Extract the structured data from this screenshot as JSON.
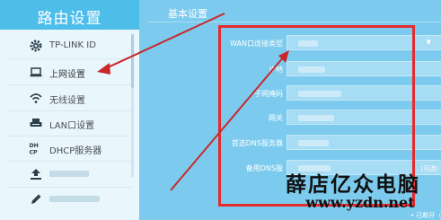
{
  "sidebar": {
    "title": "路由设置",
    "items": [
      {
        "label": "TP-LINK ID",
        "icon": "gear-icon",
        "active": false
      },
      {
        "label": "上网设置",
        "icon": "monitor-icon",
        "active": true
      },
      {
        "label": "无线设置",
        "icon": "wifi-icon",
        "active": false
      },
      {
        "label": "LAN口设置",
        "icon": "lan-switch-icon",
        "active": false
      },
      {
        "label": "DHCP服务器",
        "icon": "dhcp-icon",
        "active": false
      },
      {
        "label": "",
        "icon": "upload-icon",
        "active": false
      },
      {
        "label": "",
        "icon": "pencil-icon",
        "active": false
      }
    ]
  },
  "main": {
    "title": "基本设置",
    "fields": [
      {
        "label": "WAN口连接类型",
        "type": "select"
      },
      {
        "label": "IP地",
        "type": "input"
      },
      {
        "label": "子网掩码",
        "type": "input"
      },
      {
        "label": "网关",
        "type": "input"
      },
      {
        "label": "首选DNS服务器",
        "type": "input"
      },
      {
        "label": "备用DNS服",
        "type": "input",
        "suffix": "(可选)"
      }
    ],
    "status_text": "• 已断开（WAN口未连接"
  },
  "watermark": {
    "line1": "薛店亿众电脑",
    "line2": "www.yzdn.net"
  },
  "colors": {
    "sidebar_header": "#4dbdea",
    "sidebar_panel": "#e9f6fc",
    "main_bg": "#7ccbee",
    "highlight": "#e42c2e"
  }
}
